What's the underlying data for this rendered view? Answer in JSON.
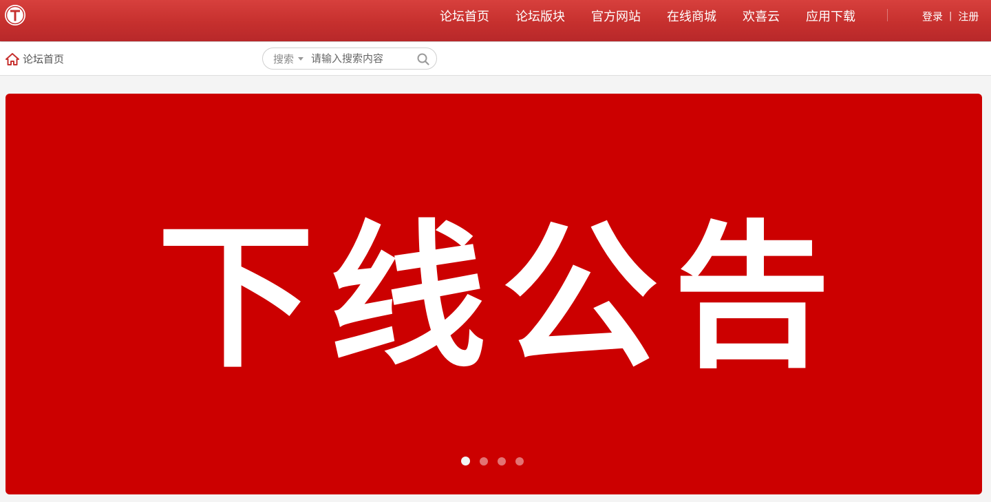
{
  "header": {
    "logo_letter": "T",
    "nav": [
      {
        "label": "论坛首页"
      },
      {
        "label": "论坛版块"
      },
      {
        "label": "官方网站"
      },
      {
        "label": "在线商城"
      },
      {
        "label": "欢喜云"
      },
      {
        "label": "应用下载"
      }
    ],
    "auth": {
      "login_label": "登录",
      "separator": "|",
      "register_label": "注册"
    }
  },
  "subbar": {
    "breadcrumb": {
      "label": "论坛首页",
      "icon": "home-icon"
    },
    "search": {
      "type_label": "搜索",
      "placeholder": "请输入搜索内容",
      "value": "",
      "icon": "search-icon"
    }
  },
  "banner": {
    "title": "下线公告",
    "slides_count": 4,
    "active_slide": 1
  },
  "colors": {
    "header_red": "#c6302e",
    "banner_red": "#cc0000",
    "text_white": "#ffffff"
  }
}
